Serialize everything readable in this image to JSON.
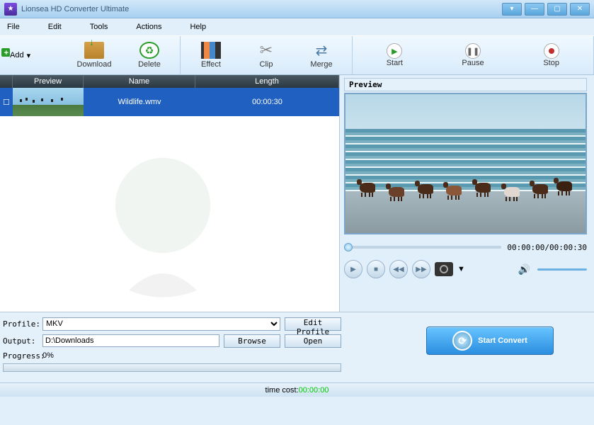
{
  "title": "Lionsea HD Converter Ultimate",
  "menu": {
    "file": "File",
    "edit": "Edit",
    "tools": "Tools",
    "actions": "Actions",
    "help": "Help"
  },
  "toolbar": {
    "add": "Add",
    "download": "Download",
    "delete": "Delete",
    "effect": "Effect",
    "clip": "Clip",
    "merge": "Merge",
    "start": "Start",
    "pause": "Pause",
    "stop": "Stop"
  },
  "list": {
    "hdr_preview": "Preview",
    "hdr_name": "Name",
    "hdr_length": "Length",
    "row0": {
      "name": "Wildlife.wmv",
      "length": "00:00:30"
    }
  },
  "preview": {
    "label": "Preview",
    "time": "00:00:00/00:00:30"
  },
  "form": {
    "profile_label": "Profile:",
    "profile_value": "MKV",
    "edit_profile": "Edit Profile",
    "output_label": "Output:",
    "output_value": "D:\\Downloads",
    "browse": "Browse",
    "open": "Open",
    "progress_label": "Progress:",
    "progress_value": "0%"
  },
  "convert_button": "Start Convert",
  "status": {
    "label": "time cost:",
    "value": "00:00:00"
  }
}
